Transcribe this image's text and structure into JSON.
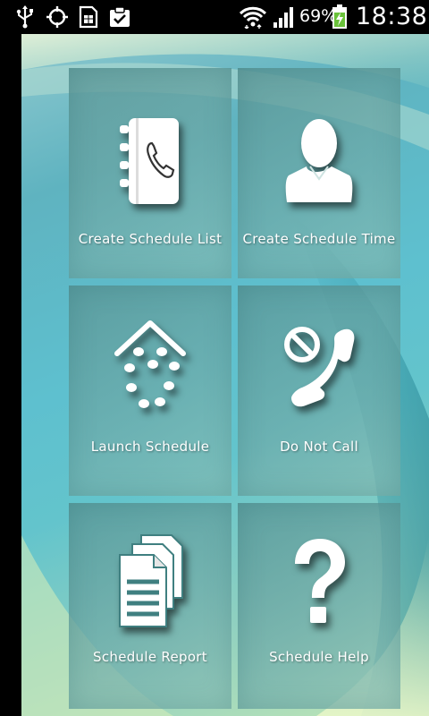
{
  "status_bar": {
    "battery_percent": "69%",
    "time": "18:38",
    "icons": [
      "usb-icon",
      "gps-icon",
      "sim-card-icon",
      "clipboard-check-icon",
      "wifi-icon",
      "signal-icon",
      "battery-charging-icon"
    ]
  },
  "tiles": [
    {
      "label": "Create Schedule List",
      "icon": "contacts-book-icon"
    },
    {
      "label": "Create Schedule Time",
      "icon": "person-icon"
    },
    {
      "label": "Launch Schedule",
      "icon": "dial-pad-launch-icon"
    },
    {
      "label": "Do Not Call",
      "icon": "do-not-call-icon"
    },
    {
      "label": "Schedule Report",
      "icon": "documents-report-icon"
    },
    {
      "label": "Schedule Help",
      "icon": "question-mark-icon"
    }
  ],
  "colors": {
    "tile_background": "#6aa9a8",
    "wallpaper": "#5ec0cf",
    "text": "#ffffff"
  }
}
